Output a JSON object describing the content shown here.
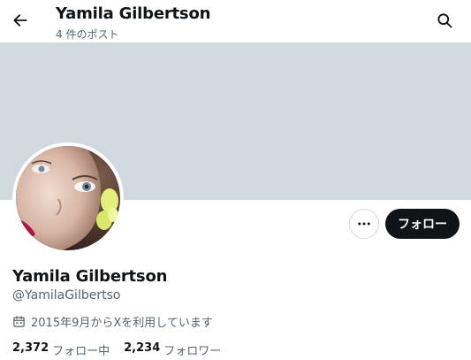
{
  "header": {
    "title": "Yamila Gilbertson",
    "subtitle": "4 件のポスト"
  },
  "icons": {
    "back": "arrow-left-icon",
    "search": "search-icon",
    "more": "more-horizontal-icon",
    "calendar": "calendar-icon"
  },
  "profile": {
    "display_name": "Yamila Gilbertson",
    "handle": "@YamilaGilbertso",
    "joined": "2015年9月からXを利用しています",
    "following_count": "2,372",
    "following_label": "フォロー中",
    "followers_count": "2,234",
    "followers_label": "フォロワー"
  },
  "actions": {
    "follow_label": "フォロー"
  },
  "colors": {
    "banner": "#cfd9de",
    "text_primary": "#0f1419",
    "text_secondary": "#536471",
    "button_dark": "#0f1419",
    "border": "#cfd9de"
  }
}
